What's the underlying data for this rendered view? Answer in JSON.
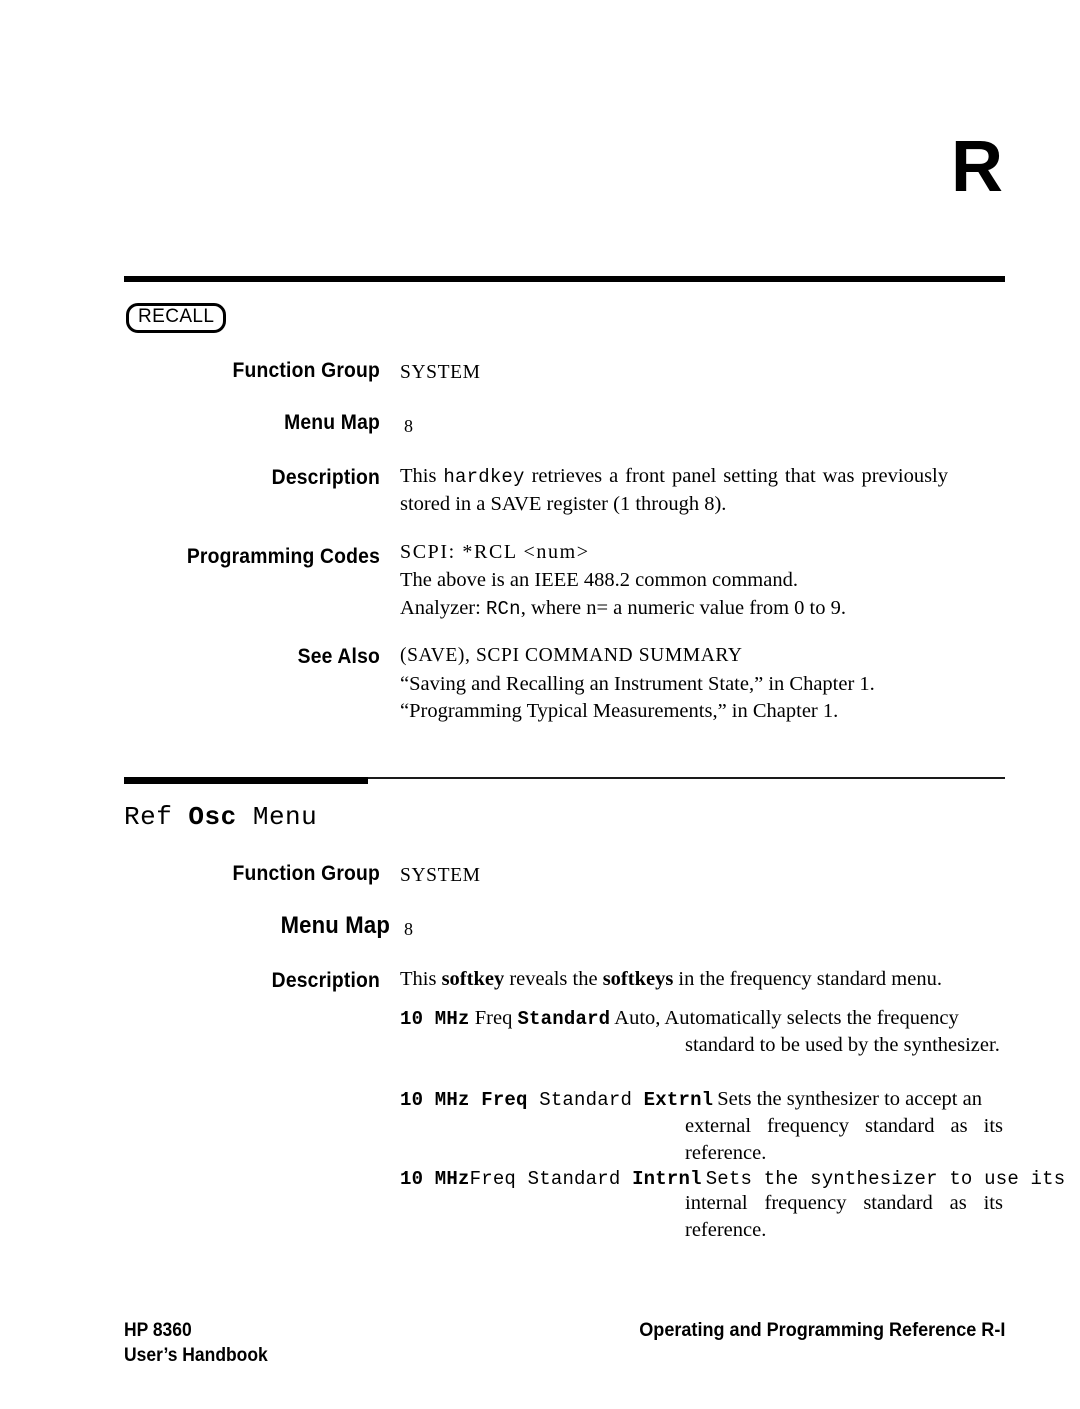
{
  "page": {
    "chapter_letter": "R"
  },
  "entry_recall": {
    "keycap_label": "RECALL",
    "fields": {
      "function_group_label": "Function Group",
      "function_group_value": "SYSTEM",
      "menu_map_label": "Menu Map",
      "menu_map_value": "8",
      "description_label": "Description",
      "description_pre": "This ",
      "description_key": "hardkey",
      "description_post": " retrieves a front panel setting that was previously stored in a SAVE register (1 through 8).",
      "programming_codes_label": "Programming Codes",
      "programming_codes_scpi": "SCPI: *RCL <num>",
      "programming_codes_line2": "The above is an IEEE 488.2 common command.",
      "programming_codes_line3_pre": "Analyzer: ",
      "programming_codes_line3_cmd": "RCn",
      "programming_codes_line3_post": ", where n= a numeric value from 0 to 9.",
      "see_also_label": "See Also",
      "see_also_line1": "(SAVE), SCPI COMMAND SUMMARY",
      "see_also_line2": "“Saving and Recalling an Instrument State,” in Chapter 1.",
      "see_also_line3": "“Programming Typical Measurements,” in Chapter 1."
    }
  },
  "entry_ref_osc": {
    "title_pre": "Ref ",
    "title_bold": "Osc",
    "title_post": " Menu",
    "fields": {
      "function_group_label": "Function Group",
      "function_group_value": "SYSTEM",
      "menu_map_label": "Menu Map",
      "menu_map_value": "8",
      "description_label": "Description",
      "description_pre": "This ",
      "description_key1": "softkey",
      "description_mid": " reveals the ",
      "description_key2": "softkeys",
      "description_post": " in the frequency standard menu."
    },
    "softkeys": [
      {
        "tokens": [
          {
            "text": "10 MHz",
            "style": "mono-bold"
          },
          {
            "text": " Freq ",
            "style": "serif"
          },
          {
            "text": "Standard",
            "style": "mono-bold"
          },
          {
            "text": " Auto,",
            "style": "serif"
          }
        ],
        "first_line": "Automatically selects the frequency",
        "continuation": "standard to be used by the synthesizer."
      },
      {
        "tokens": [
          {
            "text": "10 MHz Freq",
            "style": "mono-bold"
          },
          {
            "text": "  Standard ",
            "style": "mono"
          },
          {
            "text": "Extrnl",
            "style": "mono-bold"
          }
        ],
        "first_line": "Sets the synthesizer to accept an",
        "continuation": "external frequency standard as its reference."
      },
      {
        "tokens": [
          {
            "text": "10 MHz",
            "style": "mono-bold"
          },
          {
            "text": "Freq Standard ",
            "style": "mono"
          },
          {
            "text": "Intrnl",
            "style": "mono-bold"
          }
        ],
        "first_line": "Sets the synthesizer to use its",
        "first_line_style": "mono",
        "continuation": "internal frequency standard as its reference."
      }
    ]
  },
  "footer": {
    "left_line1": "HP 8360",
    "left_line2": "User’s Handbook",
    "right": "Operating and Programming Reference R-I"
  }
}
